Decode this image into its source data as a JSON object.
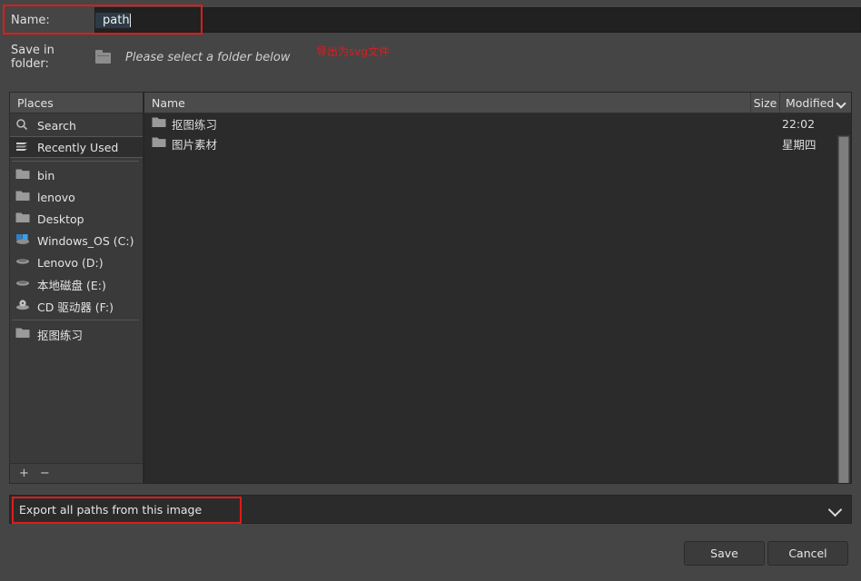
{
  "dialog": {
    "name_label": "Name:",
    "name_value": "path",
    "folder_label": "Save in folder:",
    "folder_hint": "Please select a folder below",
    "annotation": "导出为svg文件",
    "folder_icon": "folder-icon"
  },
  "places": {
    "header": "Places",
    "items": [
      {
        "label": "Search",
        "icon": "search-icon",
        "selected": false,
        "separator_after": false
      },
      {
        "label": "Recently Used",
        "icon": "recent-icon",
        "selected": true,
        "separator_after": true
      },
      {
        "label": "bin",
        "icon": "folder-icon",
        "selected": false,
        "separator_after": false
      },
      {
        "label": "lenovo",
        "icon": "folder-icon",
        "selected": false,
        "separator_after": false
      },
      {
        "label": "Desktop",
        "icon": "folder-icon",
        "selected": false,
        "separator_after": false
      },
      {
        "label": "Windows_OS (C:)",
        "icon": "windows-drive-icon",
        "selected": false,
        "separator_after": false
      },
      {
        "label": "Lenovo (D:)",
        "icon": "hard-drive-icon",
        "selected": false,
        "separator_after": false
      },
      {
        "label": "本地磁盘 (E:)",
        "icon": "hard-drive-icon",
        "selected": false,
        "separator_after": false
      },
      {
        "label": "CD 驱动器 (F:)",
        "icon": "cd-drive-icon",
        "selected": false,
        "separator_after": true
      },
      {
        "label": "抠图练习",
        "icon": "folder-icon",
        "selected": false,
        "separator_after": false
      }
    ],
    "add_label": "+",
    "remove_label": "−"
  },
  "filelist": {
    "columns": {
      "name": "Name",
      "size": "Size",
      "modified": "Modified"
    },
    "sort_indicator": "chevron-down-icon",
    "rows": [
      {
        "name": "抠图练习",
        "size": "",
        "modified": "22:02",
        "icon": "folder-icon"
      },
      {
        "name": "图片素材",
        "size": "",
        "modified": "星期四",
        "icon": "folder-icon"
      }
    ]
  },
  "export_combo": {
    "selected": "Export all paths from this image",
    "chevron": "chevron-down-icon"
  },
  "footer": {
    "save_label": "Save",
    "cancel_label": "Cancel"
  },
  "colors": {
    "background": "#454545",
    "panel": "#3a3a3a",
    "field": "#2b2b2b",
    "highlight_red": "#e01b1b",
    "annotation_red": "#d71f1f",
    "selection_blue": "#2c3b45"
  }
}
